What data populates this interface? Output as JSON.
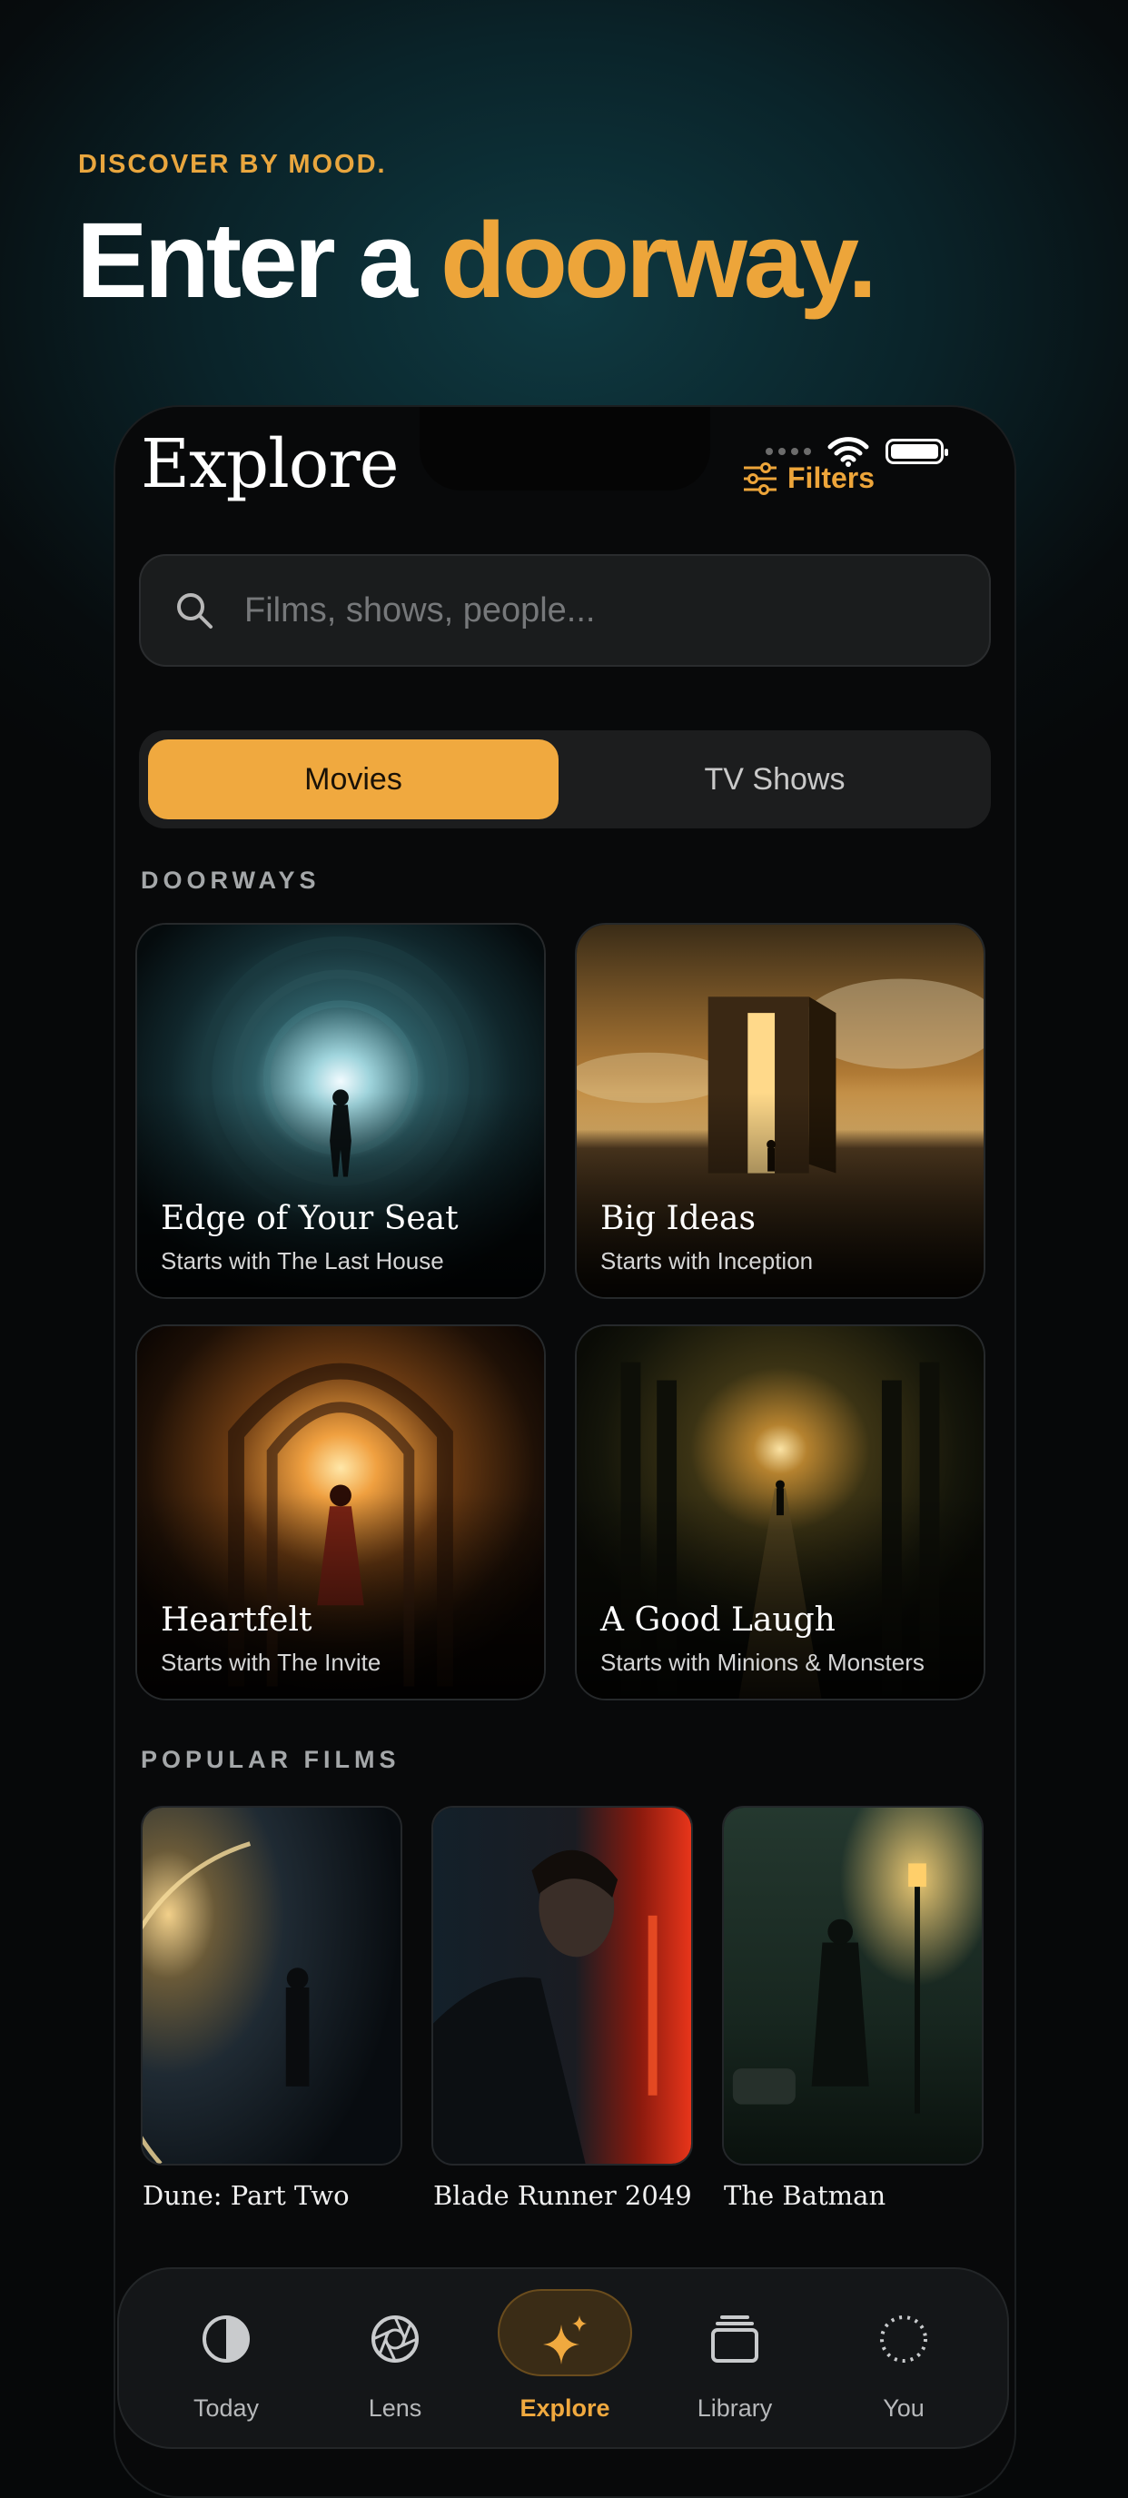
{
  "promo": {
    "kicker": "DISCOVER BY MOOD.",
    "headline_start": "Enter a ",
    "headline_accent": "doorway."
  },
  "header": {
    "title": "Explore",
    "filters_label": "Filters"
  },
  "search": {
    "placeholder": "Films, shows, people..."
  },
  "segmented": {
    "options": [
      "Movies",
      "TV Shows"
    ],
    "selected": "Movies"
  },
  "doorways": {
    "section_label": "DOORWAYS",
    "cards": [
      {
        "title": "Edge of Your Seat",
        "subtitle": "Starts with The Last House"
      },
      {
        "title": "Big Ideas",
        "subtitle": "Starts with Inception"
      },
      {
        "title": "Heartfelt",
        "subtitle": "Starts with The Invite"
      },
      {
        "title": "A Good Laugh",
        "subtitle": "Starts with Minions & Monsters"
      }
    ]
  },
  "popular": {
    "section_label": "POPULAR FILMS",
    "films": [
      {
        "title": "Dune: Part Two"
      },
      {
        "title": "Blade Runner 2049"
      },
      {
        "title": "The Batman"
      }
    ]
  },
  "tabbar": {
    "items": [
      {
        "label": "Today",
        "icon": "half-circle-icon"
      },
      {
        "label": "Lens",
        "icon": "aperture-icon"
      },
      {
        "label": "Explore",
        "icon": "sparkle-icon"
      },
      {
        "label": "Library",
        "icon": "stack-icon"
      },
      {
        "label": "You",
        "icon": "dotted-circle-icon"
      }
    ],
    "active": "Explore"
  },
  "colors": {
    "accent": "#f0a93f",
    "background": "#08090a",
    "teal_glow": "#0f3a42"
  }
}
